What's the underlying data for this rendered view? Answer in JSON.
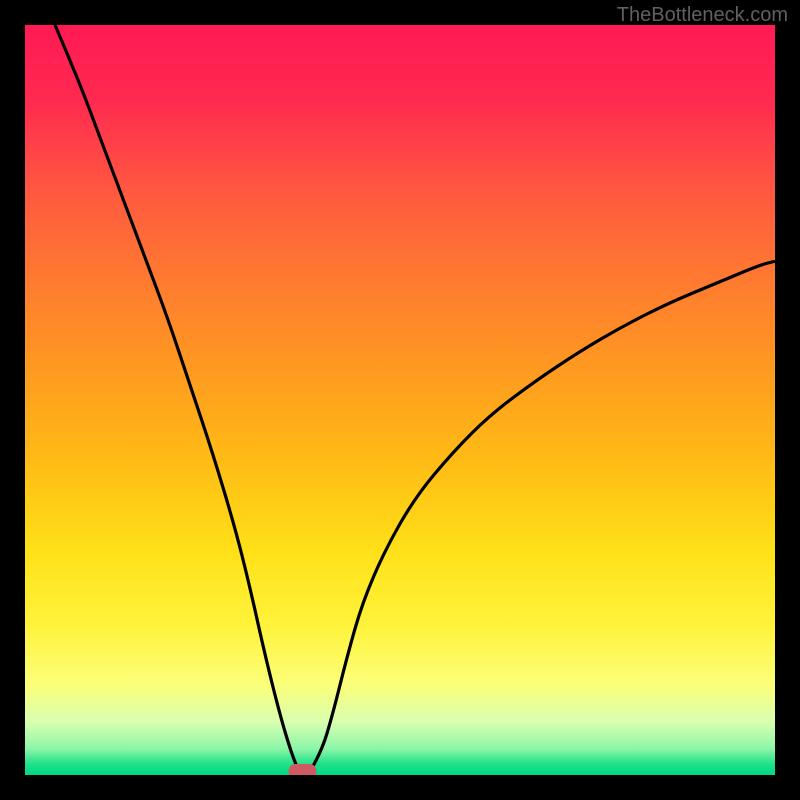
{
  "watermark": "TheBottleneck.com",
  "chart_data": {
    "type": "line",
    "title": "",
    "xlabel": "",
    "ylabel": "",
    "xlim": [
      0,
      100
    ],
    "ylim": [
      0,
      100
    ],
    "legend": false,
    "annotations": [],
    "notch_marker": {
      "x_pct": 37,
      "y_pct": 0
    },
    "curve_left": {
      "description": "Steep descending branch from top-left into the notch",
      "points_pct": [
        [
          4,
          100
        ],
        [
          7,
          93
        ],
        [
          10,
          85
        ],
        [
          13,
          77
        ],
        [
          16,
          69
        ],
        [
          19,
          61
        ],
        [
          22,
          52
        ],
        [
          25,
          43
        ],
        [
          28,
          33
        ],
        [
          30,
          25
        ],
        [
          32,
          16
        ],
        [
          34,
          8
        ],
        [
          35.5,
          3
        ],
        [
          36.5,
          0.5
        ]
      ]
    },
    "curve_right": {
      "description": "Rising branch from notch up to mid-right edge with decreasing slope",
      "points_pct": [
        [
          38.0,
          0.5
        ],
        [
          39.5,
          3
        ],
        [
          41,
          8
        ],
        [
          43,
          16
        ],
        [
          45,
          23
        ],
        [
          48,
          30
        ],
        [
          52,
          37
        ],
        [
          57,
          43
        ],
        [
          62,
          48
        ],
        [
          68,
          52.5
        ],
        [
          74,
          56.5
        ],
        [
          80,
          60
        ],
        [
          86,
          63
        ],
        [
          92,
          65.5
        ],
        [
          98,
          68
        ],
        [
          100,
          68.5
        ]
      ]
    },
    "gradient_stops": [
      {
        "offset": 0.0,
        "color": "#ff1a55"
      },
      {
        "offset": 0.1,
        "color": "#ff2a50"
      },
      {
        "offset": 0.22,
        "color": "#ff5840"
      },
      {
        "offset": 0.34,
        "color": "#ff7a30"
      },
      {
        "offset": 0.46,
        "color": "#ff9a20"
      },
      {
        "offset": 0.58,
        "color": "#ffbb15"
      },
      {
        "offset": 0.7,
        "color": "#ffe018"
      },
      {
        "offset": 0.8,
        "color": "#fff33a"
      },
      {
        "offset": 0.88,
        "color": "#fbff7a"
      },
      {
        "offset": 0.93,
        "color": "#d8ffb0"
      },
      {
        "offset": 0.965,
        "color": "#8cf5a8"
      },
      {
        "offset": 0.985,
        "color": "#20e28a"
      },
      {
        "offset": 1.0,
        "color": "#00d884"
      }
    ],
    "frame": {
      "stroke": "#000000",
      "stroke_width_px": 25
    },
    "marker_color": "#cf5a63"
  }
}
